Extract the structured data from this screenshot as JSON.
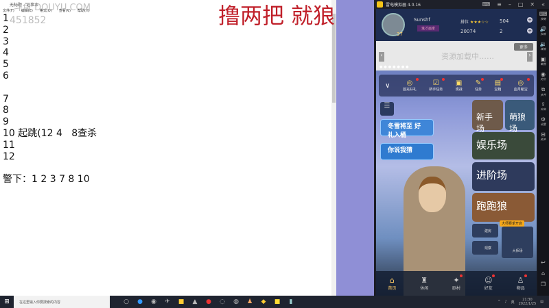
{
  "notepad": {
    "title": "无标题 - 记事本",
    "menu": [
      "文件(F)",
      "编辑(E)",
      "格式(O)",
      "查看(V)",
      "帮助(H)"
    ],
    "lines": [
      "1",
      "2",
      "3",
      "4",
      "5",
      "6",
      "",
      "7",
      "8",
      "9",
      "10 起跳(12 4   8查杀",
      "11",
      "12",
      "",
      "警下：1 2 3 7 8 10"
    ]
  },
  "watermark": {
    "site": "斗鱼 DOUYU.COM",
    "room": "451852"
  },
  "overlay_title": "撸两把 就狼",
  "emulator": {
    "title": "雷电模拟器 4.0.16",
    "sidebar": [
      "按键",
      "加音",
      "减音",
      "截图",
      "定位",
      "多开",
      "安装",
      "设置",
      "更多"
    ]
  },
  "game": {
    "level": "37",
    "username": "Sunshf",
    "user_title": "鬼才画家",
    "rank_label": "排位",
    "stars": "★★★☆☆",
    "gems": "504",
    "coins": "20074",
    "hearts": "2",
    "banner": {
      "text": "资源加载中……",
      "more": "更多",
      "dots": "●●●●●●●"
    },
    "tasks": [
      {
        "label": "首充好礼",
        "icon": "◎"
      },
      {
        "label": "新手任务",
        "icon": "☑"
      },
      {
        "label": "观战",
        "icon": "▣"
      },
      {
        "label": "任务",
        "icon": "✎"
      },
      {
        "label": "宝箱",
        "icon": "▤"
      },
      {
        "label": "血月秘宝",
        "icon": "◎"
      }
    ],
    "promos": [
      "冬雪将至 好礼入桶",
      "你说我猜"
    ],
    "modes": [
      "新手场",
      "萌狼场",
      "娱乐场",
      "进阶场",
      "跑跑狼"
    ],
    "small_buttons": [
      "建房",
      "观察"
    ],
    "master_tag": "大师赛季开启",
    "master": "大师场",
    "nav": [
      {
        "label": "首页",
        "icon": "⌂"
      },
      {
        "label": "休闲",
        "icon": "♜"
      },
      {
        "label": "剧村",
        "icon": "✦"
      },
      {
        "label": "好友",
        "icon": "☺"
      },
      {
        "label": "物品",
        "icon": "♙"
      }
    ]
  },
  "taskbar": {
    "search_placeholder": "在这里输入你要搜索的内容",
    "time": "21:30",
    "date": "2022/1/25",
    "ime": "英"
  }
}
